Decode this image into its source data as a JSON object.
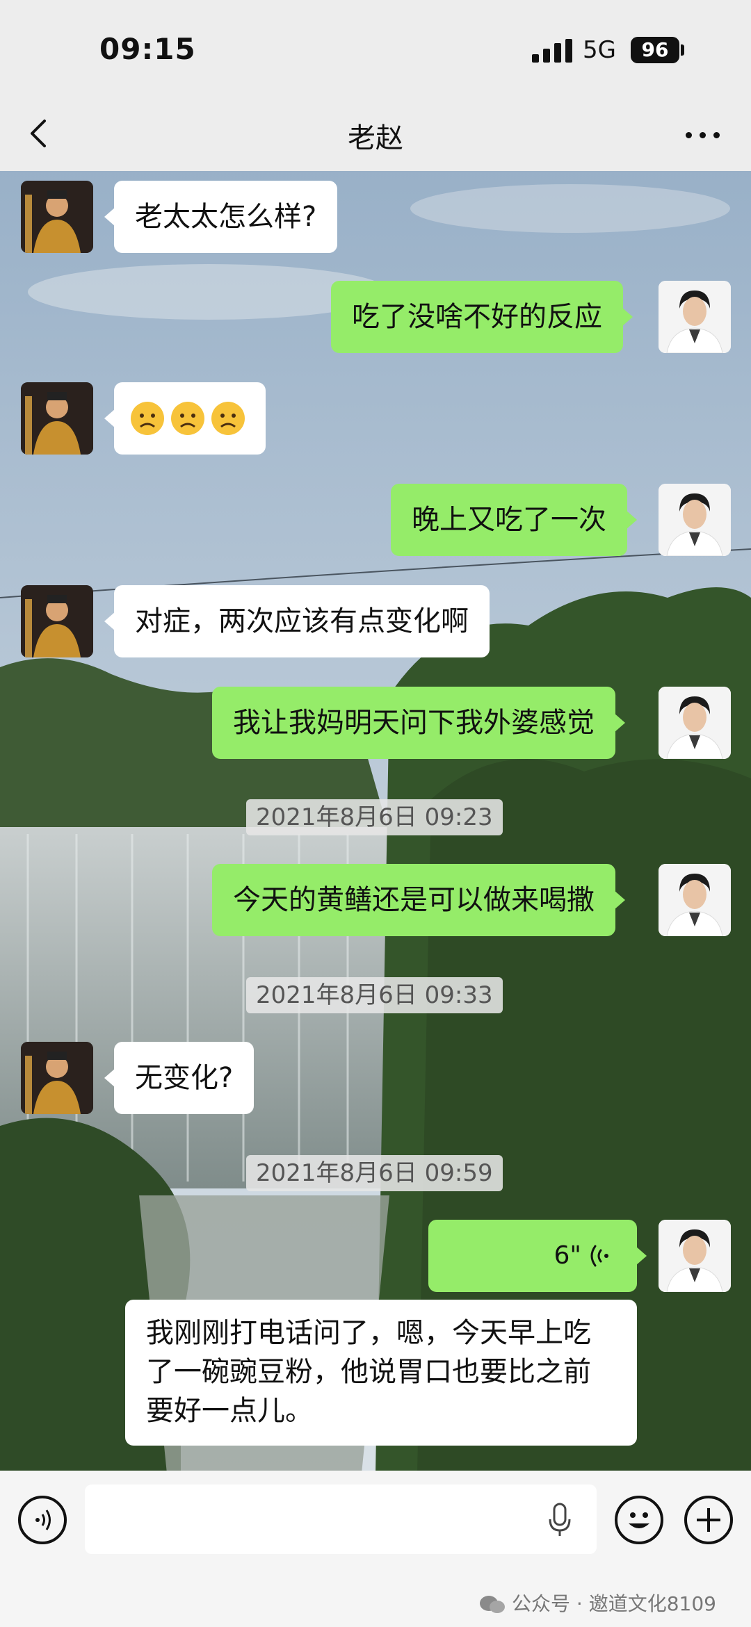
{
  "status_bar": {
    "time": "09:15",
    "network": "5G",
    "battery": "96"
  },
  "nav": {
    "title": "老赵"
  },
  "messages": [
    {
      "side": "left",
      "text": "老太太怎么样?"
    },
    {
      "side": "right",
      "text": "吃了没啥不好的反应"
    },
    {
      "side": "left",
      "text": "😟😟😟",
      "emoji_count": 3
    },
    {
      "side": "right",
      "text": "晚上又吃了一次"
    },
    {
      "side": "left",
      "text": "对症，两次应该有点变化啊"
    },
    {
      "side": "right",
      "text": "我让我妈明天问下我外婆感觉"
    },
    {
      "timestamp": "2021年8月6日 09:23"
    },
    {
      "side": "right",
      "text": "今天的黄鳝还是可以做来喝撒"
    },
    {
      "timestamp": "2021年8月6日 09:33"
    },
    {
      "side": "left",
      "text": "无变化?"
    },
    {
      "timestamp": "2021年8月6日 09:59"
    },
    {
      "side": "right",
      "type": "voice",
      "text": "6\""
    },
    {
      "side": "left",
      "text": "我刚刚打电话问了，嗯，今天早上吃了一碗豌豆粉，他说胃口也要比之前要好一点儿。"
    }
  ],
  "watermark": "公众号 · 邀道文化8109",
  "icons": [
    "back-icon",
    "more-icon",
    "voice-toggle-icon",
    "mic-icon",
    "emoji-icon",
    "plus-icon"
  ],
  "colors": {
    "bubble_right": "#95ec69",
    "bubble_left": "#ffffff",
    "header": "#ededed"
  }
}
